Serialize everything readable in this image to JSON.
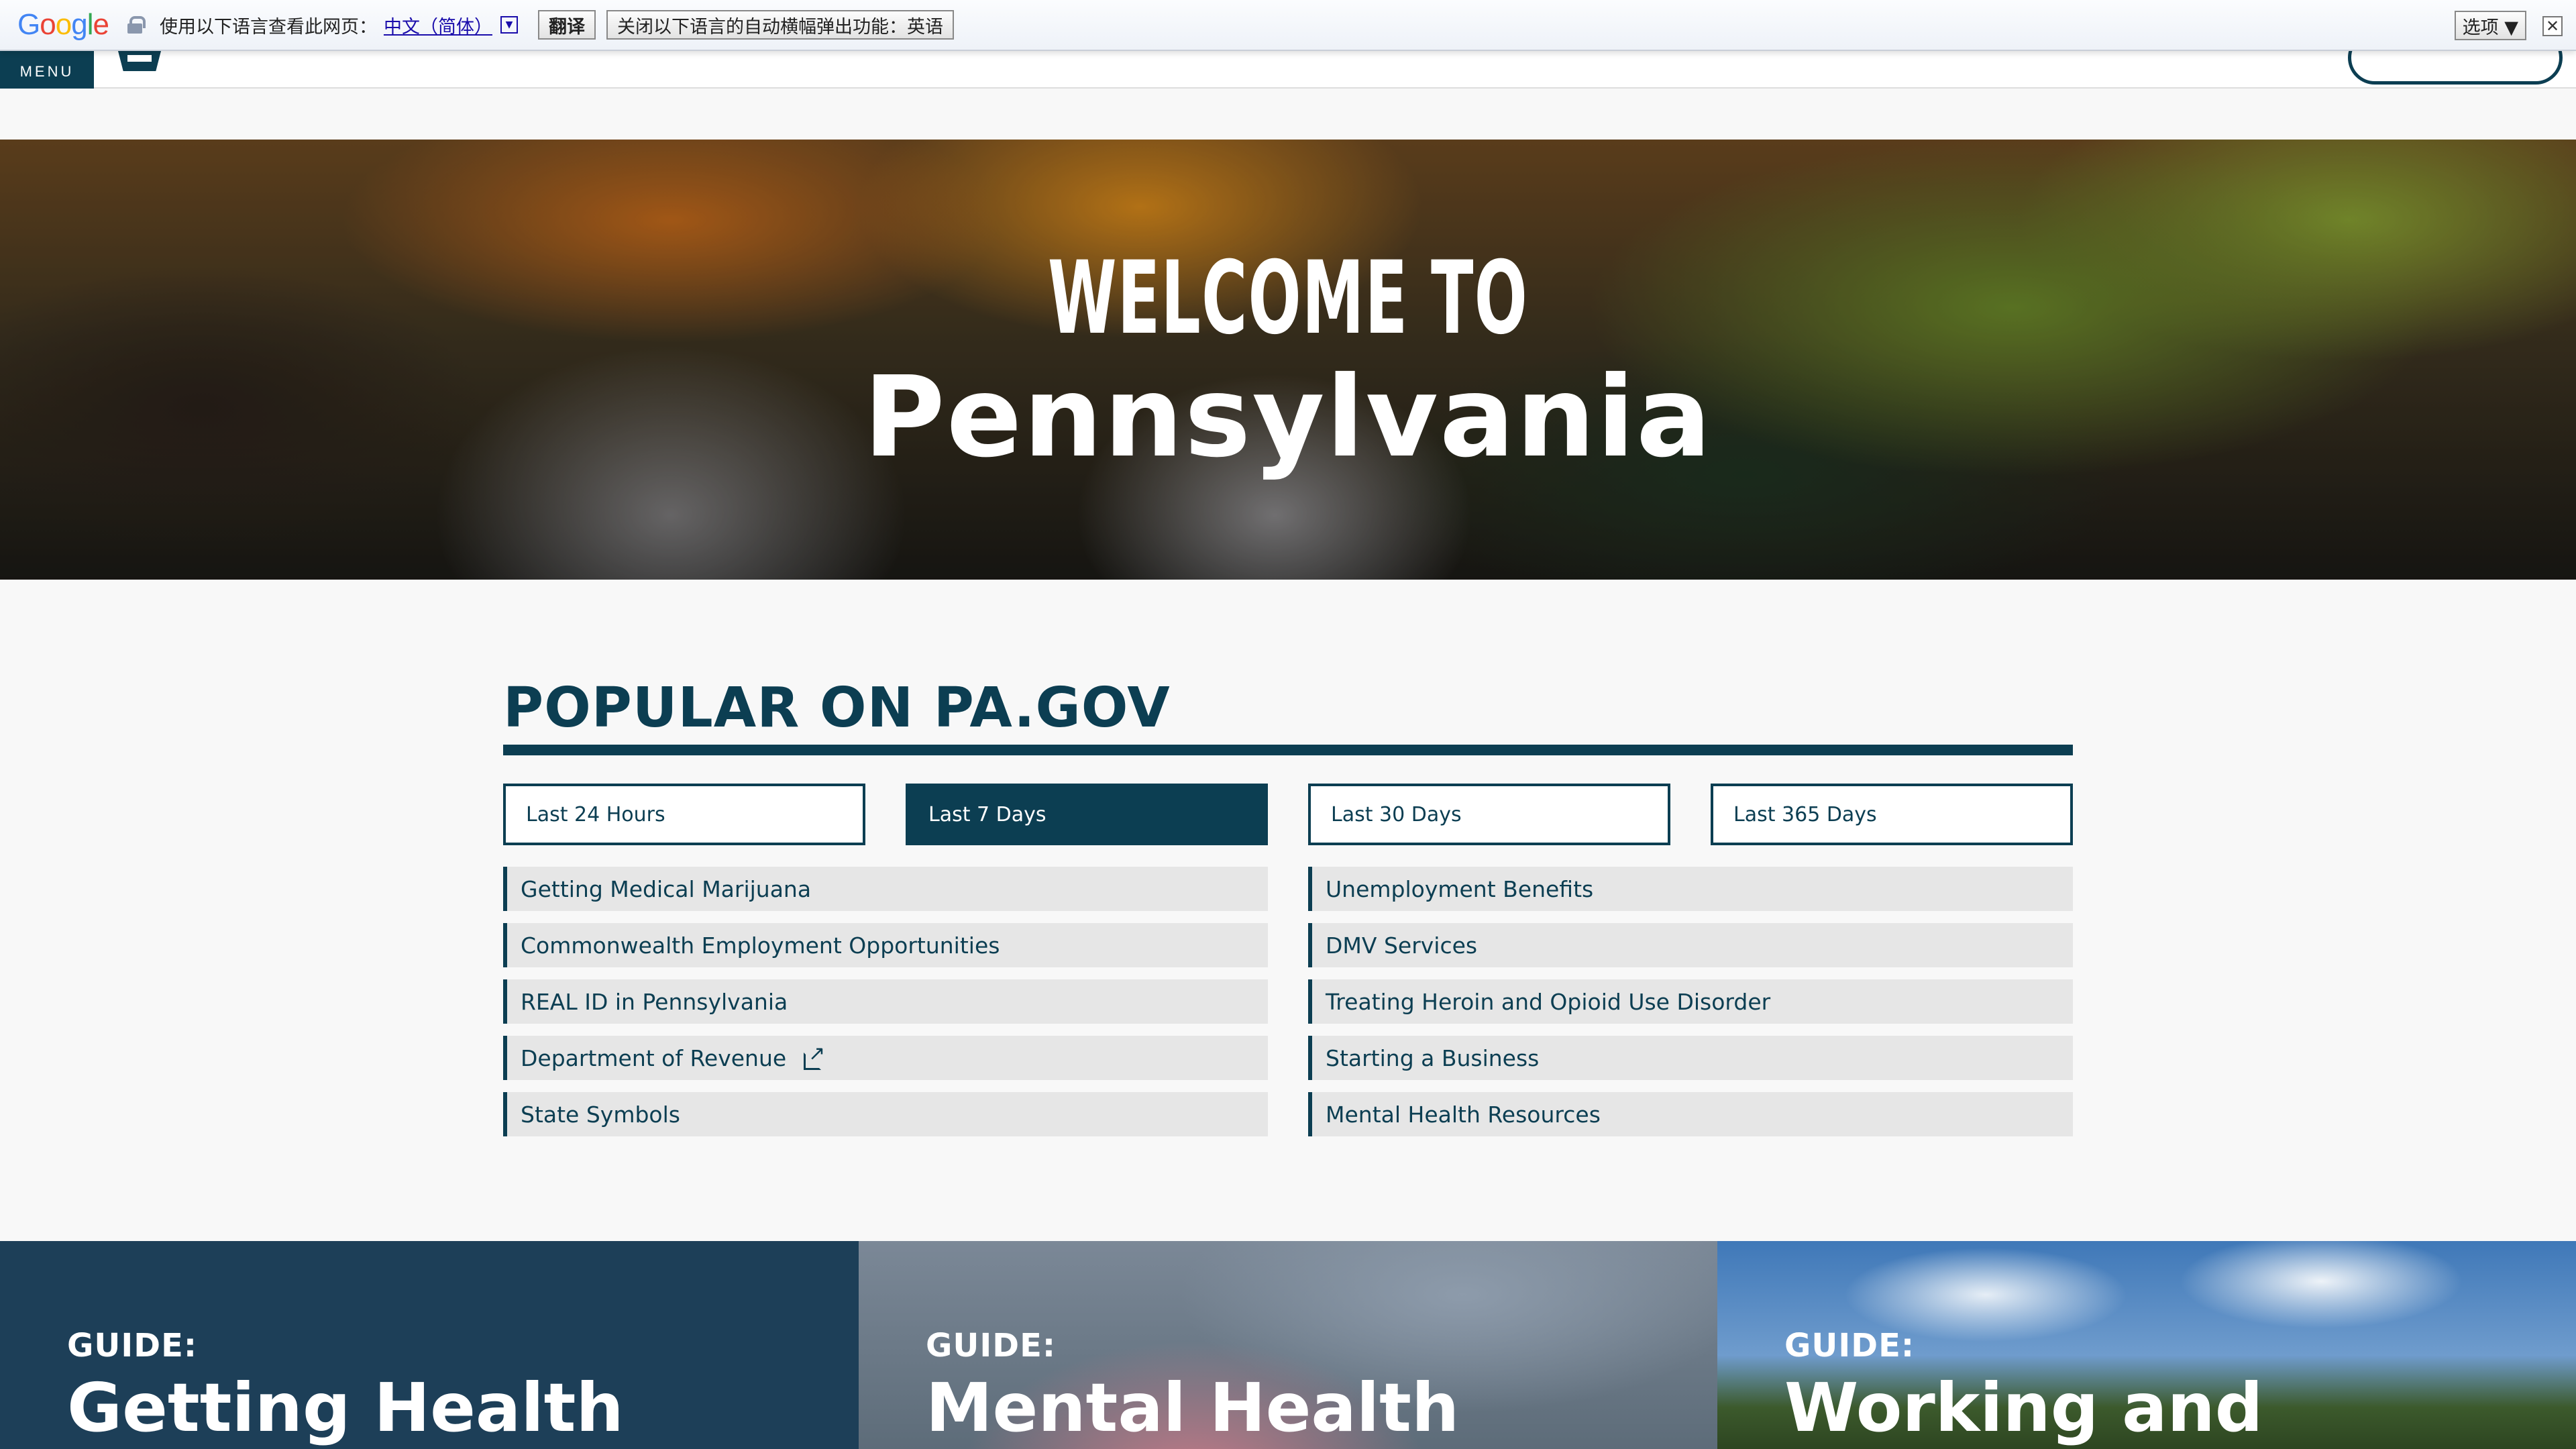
{
  "translate_bar": {
    "logo": [
      "G",
      "o",
      "o",
      "g",
      "l",
      "e"
    ],
    "logo_colors": [
      "#4285f4",
      "#ea4335",
      "#fbbc05",
      "#4285f4",
      "#34a853",
      "#ea4335"
    ],
    "prompt": "使用以下语言查看此网页：",
    "language": "中文（简体）",
    "dropdown_glyph": "▼",
    "translate_button": "翻译",
    "disable_button": "关闭以下语言的自动横幅弹出功能：英语",
    "options_button": "选项 ▼",
    "close_glyph": "✕"
  },
  "header": {
    "menu_label": "MENU"
  },
  "hero": {
    "welcome": "WELCOME TO",
    "title": "Pennsylvania"
  },
  "popular": {
    "title": "POPULAR ON PA.GOV",
    "tabs": [
      {
        "label": "Last 24 Hours",
        "active": false
      },
      {
        "label": "Last 7 Days",
        "active": true
      },
      {
        "label": "Last 30 Days",
        "active": false
      },
      {
        "label": "Last 365 Days",
        "active": false
      }
    ],
    "links": [
      "Getting Medical Marijuana",
      "Unemployment Benefits",
      "Commonwealth Employment Opportunities",
      "DMV Services",
      "REAL ID in Pennsylvania",
      "Treating Heroin and Opioid Use Disorder",
      "Department of Revenue",
      "Starting a Business",
      "State Symbols",
      "Mental Health Resources"
    ]
  },
  "guides": [
    {
      "label": "GUIDE:",
      "title": "Getting Health"
    },
    {
      "label": "GUIDE:",
      "title": "Mental Health"
    },
    {
      "label": "GUIDE:",
      "title": "Working and"
    }
  ],
  "colors": {
    "brand": "#0c3e52",
    "link_bg": "#e6e6e6"
  }
}
